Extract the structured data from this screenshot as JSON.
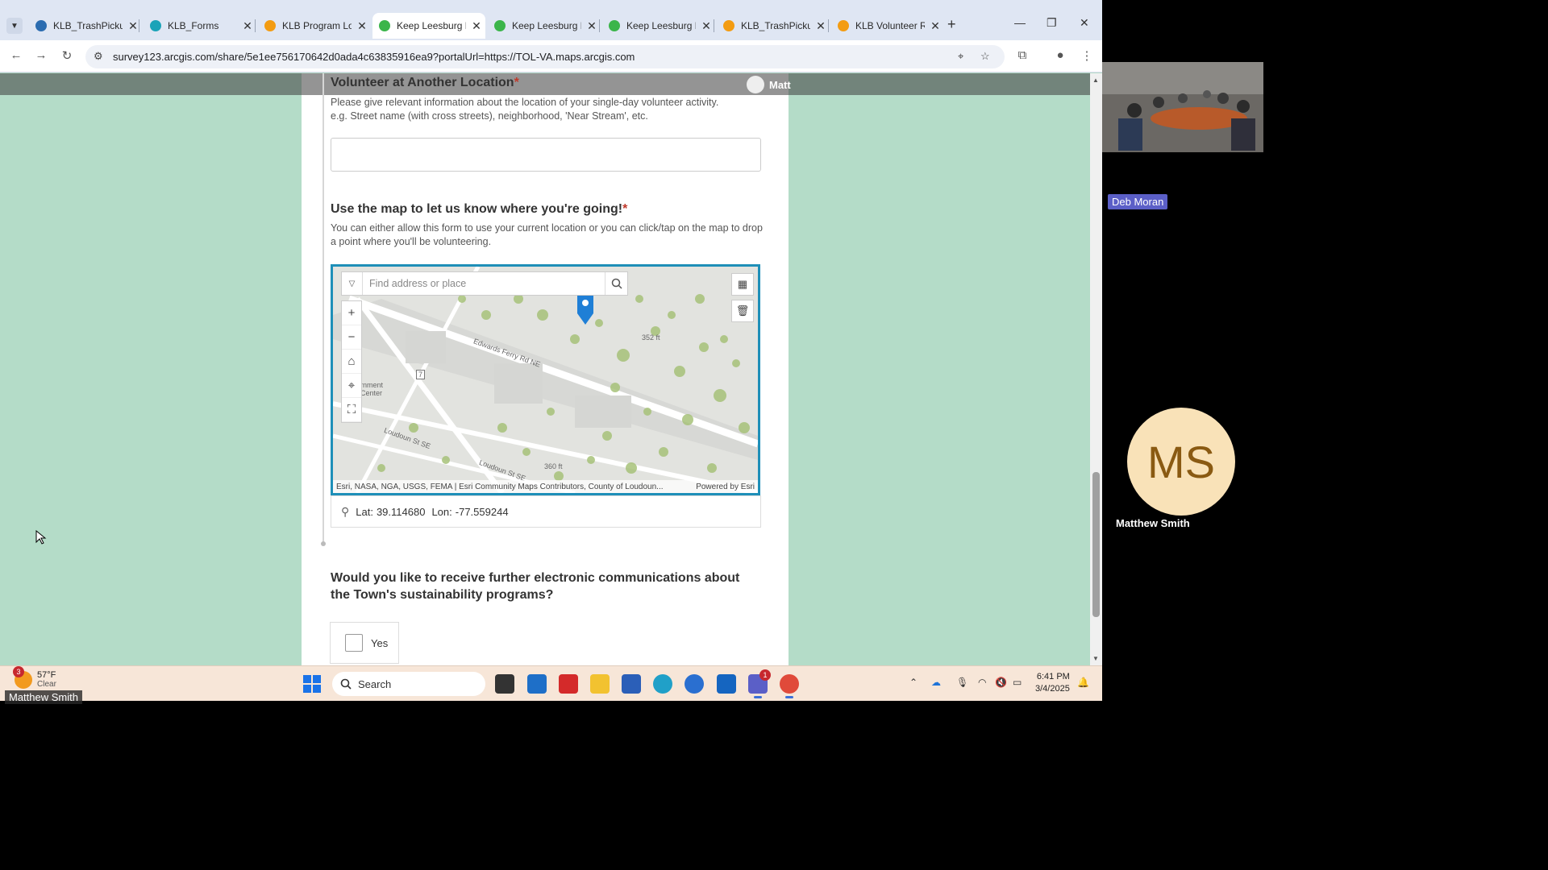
{
  "browser": {
    "tabs": [
      {
        "title": "KLB_TrashPickup",
        "color": "#2b6cb0",
        "active": false
      },
      {
        "title": "KLB_Forms",
        "color": "#1aa3b8",
        "active": false
      },
      {
        "title": "KLB Program Lo",
        "color": "#f39c12",
        "active": false
      },
      {
        "title": "Keep Leesburg E",
        "color": "#3bb54a",
        "active": true
      },
      {
        "title": "Keep Leesburg E",
        "color": "#3bb54a",
        "active": false
      },
      {
        "title": "Keep Leesburg E",
        "color": "#3bb54a",
        "active": false
      },
      {
        "title": "KLB_TrashPickup",
        "color": "#f39c12",
        "active": false
      },
      {
        "title": "KLB Volunteer R",
        "color": "#f39c12",
        "active": false
      }
    ],
    "url": "survey123.arcgis.com/share/5e1ee756170642d0ada4c63835916ea9?portalUrl=https://TOL-VA.maps.arcgis.com"
  },
  "form": {
    "account_name": "Matt",
    "q1": {
      "title": "Volunteer at Another Location",
      "required_mark": "*",
      "desc_line1": "Please give relevant information about the location of your single-day volunteer activity.",
      "desc_line2": "e.g. Street name (with cross streets), neighborhood, 'Near Stream', etc."
    },
    "q2": {
      "title": "Use the map to let us know where you're going!",
      "required_mark": "*",
      "desc": "You can either allow this form to use your current location or you can click/tap on the map to drop a point where you'll be volunteering."
    },
    "map": {
      "search_placeholder": "Find address or place",
      "labels": {
        "street1": "Edwards Ferry Rd NE",
        "street2": "Loudoun St SE",
        "street3": "Loudoun St SE",
        "elev1": "352 ft",
        "elev2": "360 ft",
        "poi": "rnment Center",
        "route": "7"
      },
      "attribution": "Esri, NASA, NGA, USGS, FEMA | Esri Community Maps Contributors, County of Loudoun...",
      "powered_by": "Powered by Esri"
    },
    "coords": {
      "lat_label": "Lat:",
      "lat": "39.114680",
      "lon_label": "Lon:",
      "lon": "-77.559244"
    },
    "q3": {
      "title": "Would you like to receive further electronic communications about the Town's sustainability programs?",
      "option_yes": "Yes"
    }
  },
  "taskbar": {
    "weather_temp": "57°F",
    "weather_cond": "Clear",
    "weather_badge": "3",
    "search_label": "Search",
    "time": "6:41 PM",
    "date": "3/4/2025",
    "teams_badge": "1"
  },
  "meeting": {
    "presenter_tag": "Matthew Smith",
    "participant1": "Deb Moran",
    "participant2_initials": "MS",
    "participant2_name": "Matthew Smith"
  }
}
